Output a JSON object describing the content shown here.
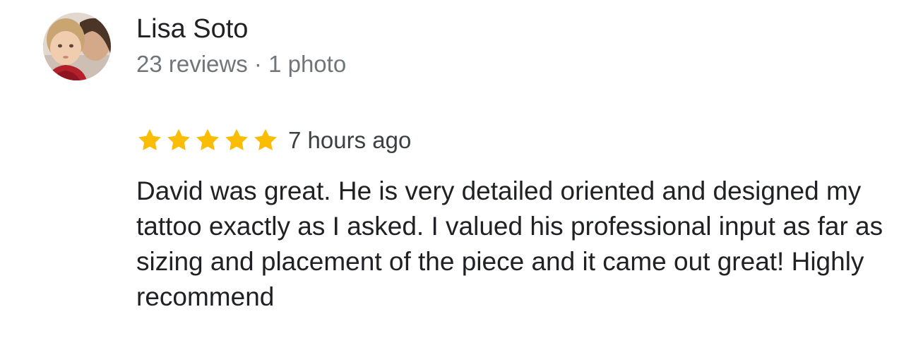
{
  "reviewer": {
    "name": "Lisa Soto",
    "reviews_count": "23 reviews",
    "separator": "·",
    "photos_count": "1 photo",
    "meta": "23 reviews · 1 photo",
    "avatar_icon": "profile-photo"
  },
  "review": {
    "rating": 5,
    "rating_max": 5,
    "star_icon": "star-icon",
    "star_color": "#fbbc04",
    "time": "7 hours ago",
    "text": "David was great. He is very detailed oriented and designed my tattoo exactly as I asked. I valued his professional input as far as sizing and placement of the piece and it came out great! Highly recommend"
  },
  "colors": {
    "name": "#202124",
    "meta": "#70757a",
    "text": "#202124"
  }
}
